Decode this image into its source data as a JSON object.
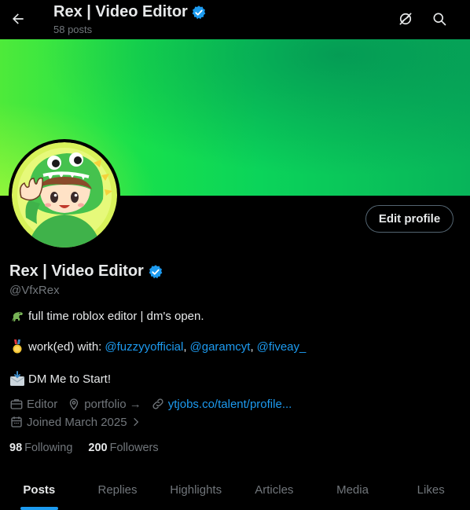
{
  "header": {
    "title": "Rex | Video Editor",
    "post_count": "58 posts",
    "icons": [
      "back-arrow-icon",
      "grok-icon",
      "search-icon"
    ]
  },
  "profile": {
    "name": "Rex | Video Editor",
    "handle": "@VfxRex",
    "edit_label": "Edit profile",
    "bio": {
      "line1": "full time roblox editor | dm's open.",
      "line2_prefix": "work(ed) with:",
      "mentions": [
        "@fuzzyyofficial",
        "@garamcyt",
        "@fiveay_"
      ],
      "line3": "DM Me to Start!"
    },
    "meta": {
      "profession": "Editor",
      "location": "portfolio →",
      "website": "ytjobs.co/talent/profile...",
      "joined": "Joined March 2025"
    },
    "following_count": "98",
    "following_label": "Following",
    "followers_count": "200",
    "followers_label": "Followers"
  },
  "tabs": [
    "Posts",
    "Replies",
    "Highlights",
    "Articles",
    "Media",
    "Likes"
  ],
  "colors": {
    "accent": "#1d9bf0",
    "muted": "#71767b",
    "text": "#e7e9ea",
    "banner_start": "#4eea3a",
    "banner_end": "#08b45a"
  }
}
